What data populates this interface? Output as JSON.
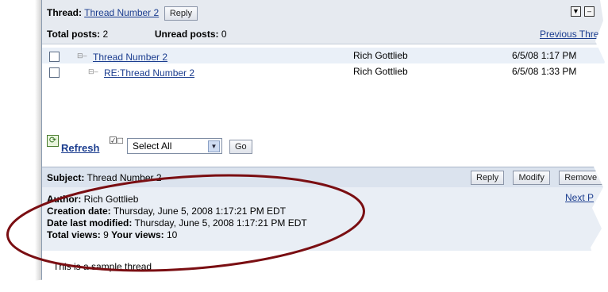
{
  "header": {
    "thread_label": "Thread:",
    "thread_name": "Thread Number 2",
    "reply_label": "Reply",
    "total_posts_label": "Total posts:",
    "total_posts_value": "2",
    "unread_posts_label": "Unread posts:",
    "unread_posts_value": "0",
    "previous_link": "Previous Threa",
    "icons": [
      "download-icon",
      "minimize-icon"
    ]
  },
  "posts": [
    {
      "title": "Thread Number 2",
      "author": "Rich Gottlieb",
      "date": "6/5/08 1:17 PM"
    },
    {
      "title": "RE:Thread Number 2",
      "author": "Rich Gottlieb",
      "date": "6/5/08 1:33 PM"
    }
  ],
  "toolbar": {
    "refresh_label": "Refresh",
    "select_value": "Select All",
    "go_label": "Go"
  },
  "subject": {
    "label": "Subject:",
    "value": "Thread Number 2",
    "buttons": [
      "Reply",
      "Modify",
      "Remove"
    ]
  },
  "meta": {
    "author_label": "Author:",
    "author_value": "Rich Gottlieb",
    "created_label": "Creation date:",
    "created_value": "Thursday, June 5, 2008 1:17:21 PM EDT",
    "modified_label": "Date last modified:",
    "modified_value": "Thursday, June 5, 2008 1:17:21 PM EDT",
    "total_views_label": "Total views:",
    "total_views_value": "9",
    "your_views_label": "Your views:",
    "your_views_value": "10",
    "next_link": "Next P"
  },
  "body_text": "This is a sample thread",
  "colors": {
    "annotation_ring": "#7a0e12",
    "link": "#1b3d8f",
    "header_bg": "#e6eaf0"
  }
}
